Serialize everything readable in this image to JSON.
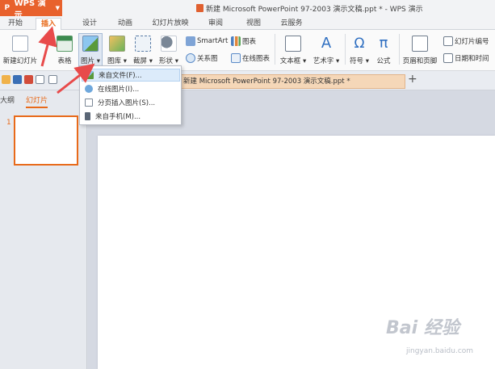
{
  "app": {
    "name": "WPS 演示",
    "doc_title": "新建 Microsoft PowerPoint 97-2003 演示文稿.ppt * - WPS 演示"
  },
  "tabs": [
    {
      "label": "开始"
    },
    {
      "label": "插入"
    },
    {
      "label": "设计"
    },
    {
      "label": "动画"
    },
    {
      "label": "幻灯片放映"
    },
    {
      "label": "审阅"
    },
    {
      "label": "视图"
    },
    {
      "label": "云服务"
    }
  ],
  "ribbon": {
    "new_slide": "新建幻灯片",
    "table": "表格",
    "picture": "图片",
    "gallery": "图库",
    "screenshot": "截屏",
    "shape": "形状",
    "smartart": "SmartArt",
    "chart": "图表",
    "relation": "关系图",
    "online_chart": "在线图表",
    "textbox": "文本框",
    "wordart": "艺术字",
    "symbol": "符号",
    "formula": "公式",
    "header_footer": "页眉和页脚",
    "slide_number": "幻灯片编号",
    "datetime": "日期和时间"
  },
  "document_tab": "新建 Microsoft PowerPoint 97-2003 演示文稿.ppt *",
  "left_pane": {
    "outline_tab": "大纲",
    "slides_tab": "幻灯片",
    "slide_number": "1"
  },
  "picture_menu": {
    "items": [
      {
        "label": "来自文件(F)..."
      },
      {
        "label": "在线图片(I)..."
      },
      {
        "label": "分页插入图片(S)..."
      },
      {
        "label": "来自手机(M)..."
      }
    ]
  },
  "watermark": {
    "brand": "Bai 经验",
    "url": "jingyan.baidu.com"
  },
  "colors": {
    "accent": "#e86a1a",
    "app_button": "#e8612c",
    "annotation_arrow": "#e84a4a"
  }
}
